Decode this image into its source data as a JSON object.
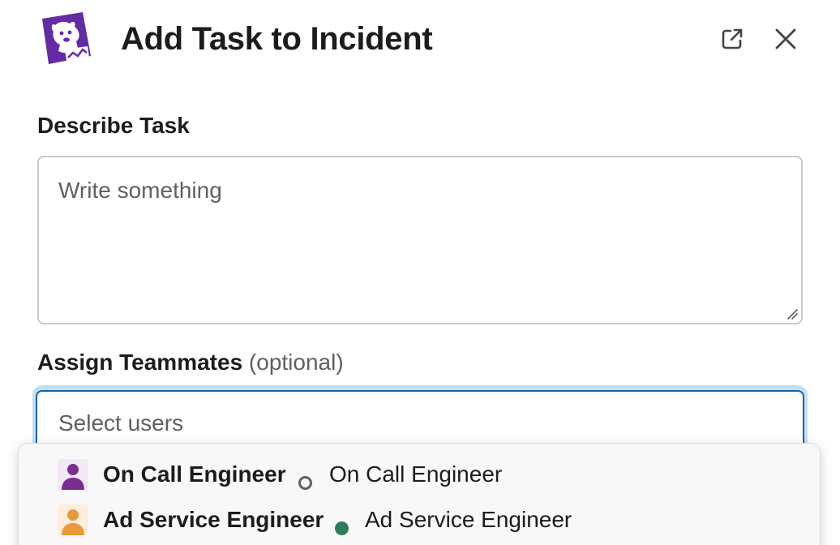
{
  "modal": {
    "title": "Add Task to Incident",
    "logo_icon": "datadog-logo-icon",
    "popout_icon": "external-link-icon",
    "close_icon": "close-icon"
  },
  "describe_task": {
    "label": "Describe Task",
    "placeholder": "Write something"
  },
  "assign": {
    "label": "Assign Teammates",
    "optional": "(optional)",
    "placeholder": "Select users"
  },
  "options": [
    {
      "name": "On Call Engineer",
      "status": "away",
      "subtitle": "On Call Engineer",
      "avatar_color": "#7b2e91"
    },
    {
      "name": "Ad Service Engineer",
      "status": "active",
      "subtitle": "Ad Service Engineer",
      "avatar_color": "#e8993a"
    }
  ],
  "colors": {
    "brand_purple": "#632ca6",
    "focus_blue": "#1264a3",
    "status_active": "#2f7a5a"
  }
}
